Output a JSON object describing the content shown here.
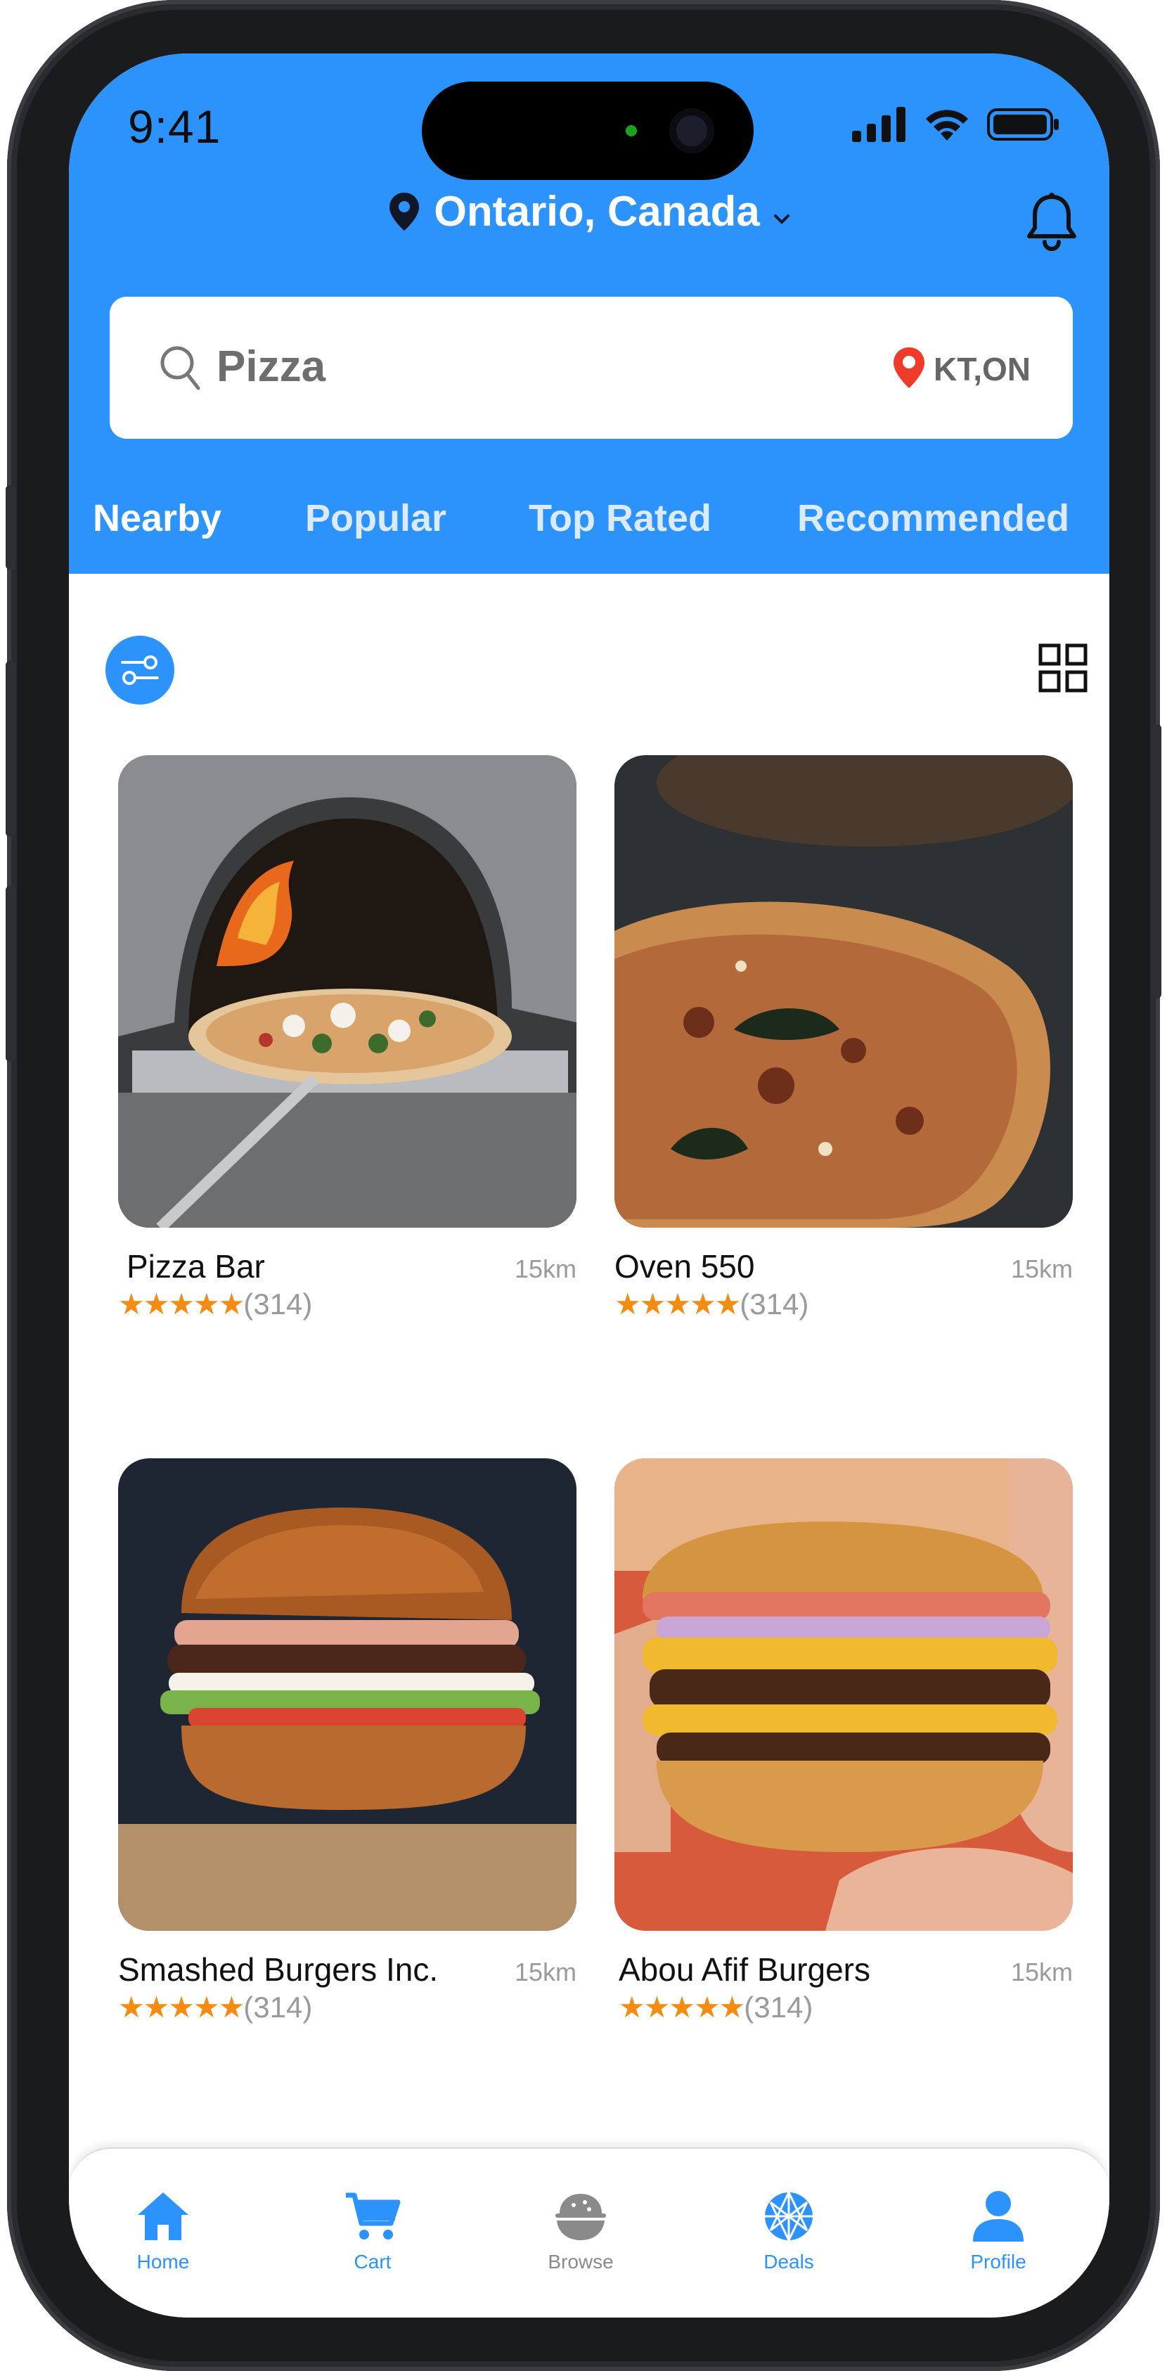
{
  "status_bar": {
    "time": "9:41"
  },
  "header": {
    "location": "Ontario, Canada",
    "search": {
      "value": "Pizza",
      "location_code": "KT,ON"
    },
    "tabs": [
      {
        "label": "Nearby",
        "active": true
      },
      {
        "label": "Popular",
        "active": false
      },
      {
        "label": "Top Rated",
        "active": false
      },
      {
        "label": "Recommended",
        "active": false
      }
    ]
  },
  "listings": [
    {
      "name": "Pizza Bar",
      "distance": "15km",
      "stars": "★★★★★",
      "reviews": "(314)",
      "image": "pizza-oven-photo"
    },
    {
      "name": "Oven 550",
      "distance": "15km",
      "stars": "★★★★★",
      "reviews": "(314)",
      "image": "pizza-closeup-photo"
    },
    {
      "name": "Smashed Burgers Inc.",
      "distance": "15km",
      "stars": "★★★★★",
      "reviews": "(314)",
      "image": "burger-photo"
    },
    {
      "name": "Abou Afif Burgers",
      "distance": "15km",
      "stars": "★★★★★",
      "reviews": "(314)",
      "image": "burger-in-hands-photo"
    }
  ],
  "bottom_nav": [
    {
      "label": "Home",
      "icon": "home-icon",
      "active": true
    },
    {
      "label": "Cart",
      "icon": "cart-icon",
      "active": true
    },
    {
      "label": "Browse",
      "icon": "rice-bowl-icon",
      "active": false
    },
    {
      "label": "Deals",
      "icon": "globe-icon",
      "active": true
    },
    {
      "label": "Profile",
      "icon": "user-icon",
      "active": true
    }
  ],
  "colors": {
    "accent": "#2b93fb",
    "star": "#f48b12",
    "pin_red": "#ef3b2a"
  }
}
